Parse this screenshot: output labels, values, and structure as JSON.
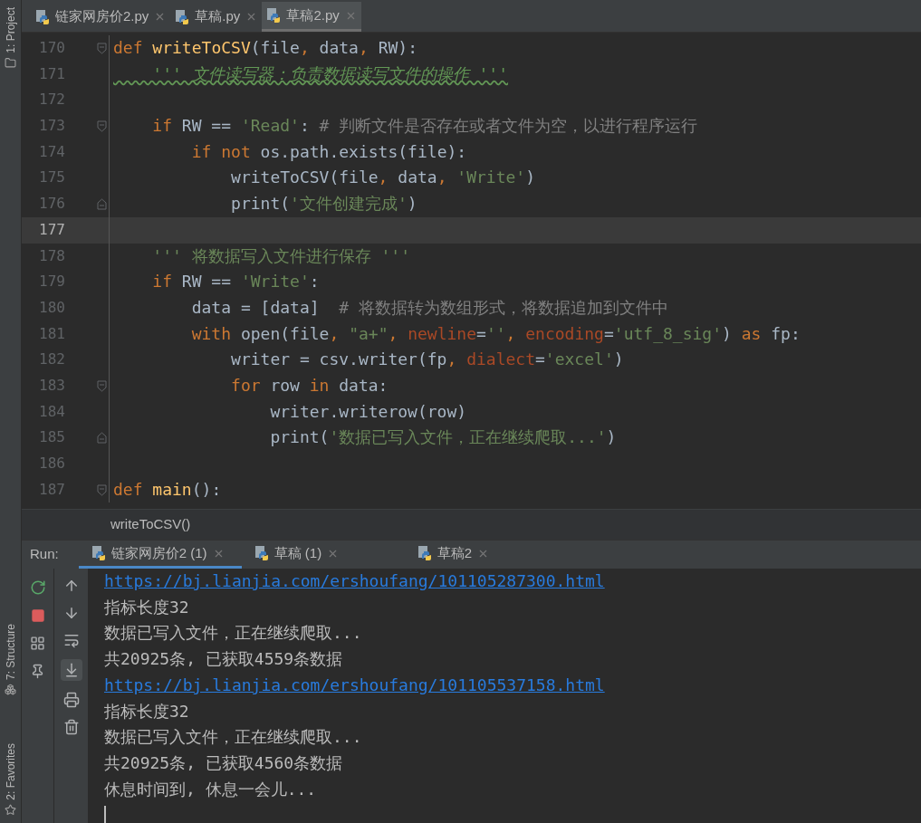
{
  "side_tools": [
    {
      "label": "1: Project",
      "kind": "folder"
    },
    {
      "label": "7: Structure",
      "kind": "structure"
    },
    {
      "label": "2: Favorites",
      "kind": "star"
    }
  ],
  "editor_tabs": [
    {
      "label": "链家网房价2.py",
      "selected": false
    },
    {
      "label": "草稿.py",
      "selected": false
    },
    {
      "label": "草稿2.py",
      "selected": true
    }
  ],
  "code_lines": [
    {
      "number": "170",
      "kind": "fold_start",
      "current": false,
      "tokens": [
        {
          "kind": "kw",
          "text": "def "
        },
        {
          "kind": "fn",
          "text": "writeToCSV"
        },
        {
          "kind": "plain",
          "text": "(file"
        },
        {
          "kind": "kw",
          "text": ", "
        },
        {
          "kind": "plain",
          "text": "data"
        },
        {
          "kind": "kw",
          "text": ", "
        },
        {
          "kind": "plain",
          "text": "RW):"
        }
      ]
    },
    {
      "number": "171",
      "kind": "plain",
      "current": false,
      "tokens": [
        {
          "kind": "doc",
          "text": "    ''' 文件读写器：负责数据读写文件的操作 '''"
        }
      ]
    },
    {
      "number": "172",
      "kind": "plain",
      "current": false
    },
    {
      "number": "173",
      "kind": "fold_start",
      "current": false,
      "tokens": [
        {
          "kind": "kw",
          "text": "    if "
        },
        {
          "kind": "plain",
          "text": "RW == "
        },
        {
          "kind": "str",
          "text": "'Read'"
        },
        {
          "kind": "plain",
          "text": ": "
        },
        {
          "kind": "cmt",
          "text": "# 判断文件是否存在或者文件为空，以进行程序运行"
        }
      ]
    },
    {
      "number": "174",
      "kind": "plain",
      "current": false,
      "tokens": [
        {
          "kind": "kw",
          "text": "        if not "
        },
        {
          "kind": "plain",
          "text": "os.path.exists(file):"
        }
      ]
    },
    {
      "number": "175",
      "kind": "plain",
      "current": false,
      "tokens": [
        {
          "kind": "plain",
          "text": "            writeToCSV(file"
        },
        {
          "kind": "kw",
          "text": ", "
        },
        {
          "kind": "plain",
          "text": "data"
        },
        {
          "kind": "kw",
          "text": ", "
        },
        {
          "kind": "str",
          "text": "'Write'"
        },
        {
          "kind": "plain",
          "text": ")"
        }
      ]
    },
    {
      "number": "176",
      "kind": "fold_end",
      "current": false,
      "tokens": [
        {
          "kind": "builtin",
          "text": "            print"
        },
        {
          "kind": "plain",
          "text": "("
        },
        {
          "kind": "str",
          "text": "'文件创建完成'"
        },
        {
          "kind": "plain",
          "text": ")"
        }
      ]
    },
    {
      "number": "177",
      "kind": "plain",
      "current": true
    },
    {
      "number": "178",
      "kind": "plain",
      "current": false,
      "tokens": [
        {
          "kind": "str",
          "text": "    ''' 将数据写入文件进行保存 '''"
        }
      ]
    },
    {
      "number": "179",
      "kind": "plain",
      "current": false,
      "tokens": [
        {
          "kind": "kw",
          "text": "    if "
        },
        {
          "kind": "plain",
          "text": "RW == "
        },
        {
          "kind": "str",
          "text": "'Write'"
        },
        {
          "kind": "plain",
          "text": ":"
        }
      ]
    },
    {
      "number": "180",
      "kind": "plain",
      "current": false,
      "tokens": [
        {
          "kind": "plain",
          "text": "        data = [data]  "
        },
        {
          "kind": "cmt",
          "text": "# 将数据转为数组形式，将数据追加到文件中"
        }
      ]
    },
    {
      "number": "181",
      "kind": "plain",
      "current": false,
      "tokens": [
        {
          "kind": "kw",
          "text": "        with "
        },
        {
          "kind": "builtin",
          "text": "open"
        },
        {
          "kind": "plain",
          "text": "(file"
        },
        {
          "kind": "kw",
          "text": ", "
        },
        {
          "kind": "str",
          "text": "\"a+\""
        },
        {
          "kind": "kw",
          "text": ", "
        },
        {
          "kind": "arg",
          "text": "newline"
        },
        {
          "kind": "plain",
          "text": "="
        },
        {
          "kind": "str",
          "text": "''"
        },
        {
          "kind": "kw",
          "text": ", "
        },
        {
          "kind": "arg",
          "text": "encoding"
        },
        {
          "kind": "plain",
          "text": "="
        },
        {
          "kind": "str",
          "text": "'utf_8_sig'"
        },
        {
          "kind": "plain",
          "text": ") "
        },
        {
          "kind": "kw",
          "text": "as "
        },
        {
          "kind": "plain",
          "text": "fp:"
        }
      ]
    },
    {
      "number": "182",
      "kind": "plain",
      "current": false,
      "tokens": [
        {
          "kind": "plain",
          "text": "            writer = csv.writer(fp"
        },
        {
          "kind": "kw",
          "text": ", "
        },
        {
          "kind": "arg",
          "text": "dialect"
        },
        {
          "kind": "plain",
          "text": "="
        },
        {
          "kind": "str",
          "text": "'excel'"
        },
        {
          "kind": "plain",
          "text": ")"
        }
      ]
    },
    {
      "number": "183",
      "kind": "fold_start",
      "current": false,
      "tokens": [
        {
          "kind": "kw",
          "text": "            for "
        },
        {
          "kind": "plain",
          "text": "row "
        },
        {
          "kind": "kw",
          "text": "in "
        },
        {
          "kind": "plain",
          "text": "data:"
        }
      ]
    },
    {
      "number": "184",
      "kind": "plain",
      "current": false,
      "tokens": [
        {
          "kind": "plain",
          "text": "                writer.writerow(row)"
        }
      ]
    },
    {
      "number": "185",
      "kind": "fold_end",
      "current": false,
      "tokens": [
        {
          "kind": "builtin",
          "text": "                print"
        },
        {
          "kind": "plain",
          "text": "("
        },
        {
          "kind": "str",
          "text": "'数据已写入文件，正在继续爬取...'"
        },
        {
          "kind": "plain",
          "text": ")"
        }
      ]
    },
    {
      "number": "186",
      "kind": "plain",
      "current": false
    },
    {
      "number": "187",
      "kind": "fold_start",
      "current": false,
      "tokens": [
        {
          "kind": "kw",
          "text": "def "
        },
        {
          "kind": "fn",
          "text": "main"
        },
        {
          "kind": "plain",
          "text": "():"
        }
      ]
    }
  ],
  "breadcrumb": "writeToCSV()",
  "run": {
    "label": "Run:",
    "tabs": [
      {
        "label": "链家网房价2 (1)",
        "selected": true
      },
      {
        "label": "草稿 (1)",
        "selected": false
      },
      {
        "label": "草稿2",
        "selected": false
      }
    ]
  },
  "console_lines": [
    {
      "kind": "link",
      "text": "https://bj.lianjia.com/ershoufang/101105287300.html"
    },
    {
      "kind": "text",
      "text": "指标长度32"
    },
    {
      "kind": "text",
      "text": "数据已写入文件，正在继续爬取..."
    },
    {
      "kind": "text",
      "text": "共20925条, 已获取4559条数据"
    },
    {
      "kind": "link",
      "text": "https://bj.lianjia.com/ershoufang/101105537158.html"
    },
    {
      "kind": "text",
      "text": "指标长度32"
    },
    {
      "kind": "text",
      "text": "数据已写入文件，正在继续爬取..."
    },
    {
      "kind": "text",
      "text": "共20925条, 已获取4560条数据"
    },
    {
      "kind": "text",
      "text": "休息时间到, 休息一会儿..."
    },
    {
      "kind": "caret"
    }
  ]
}
